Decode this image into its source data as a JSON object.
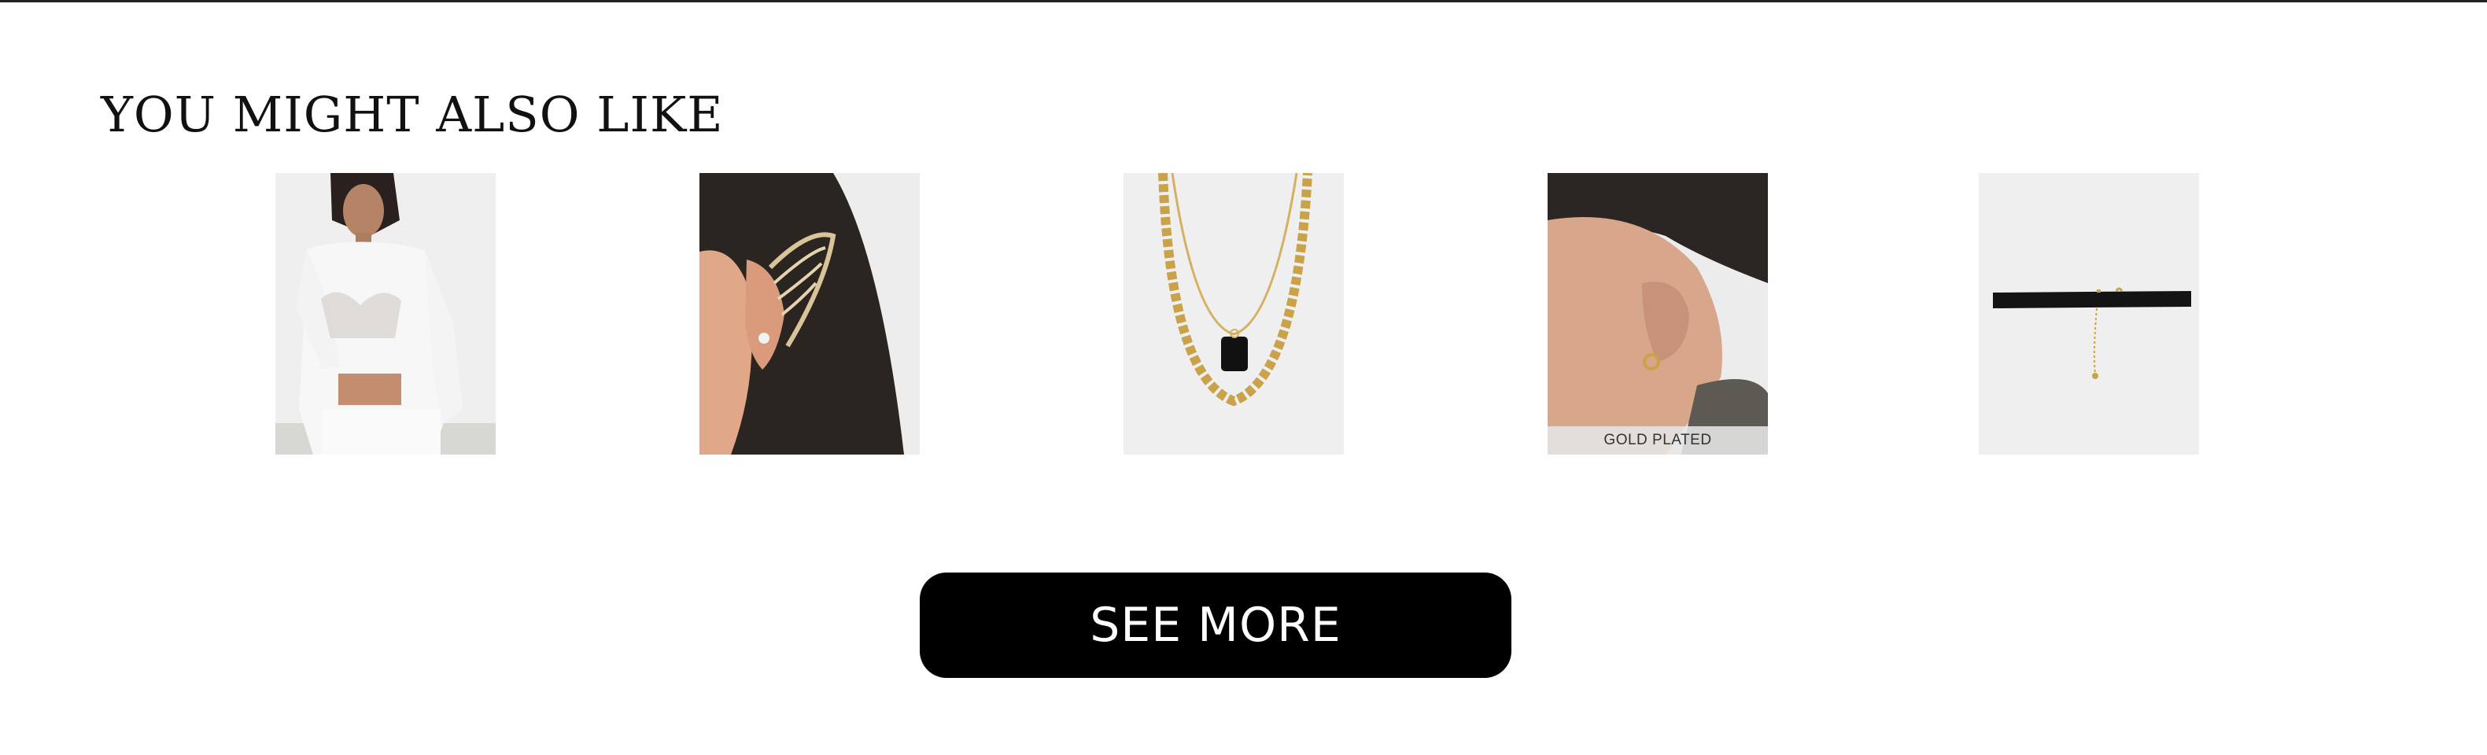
{
  "section": {
    "title": "YOU MIGHT ALSO LIKE"
  },
  "products": [
    {
      "icon": "model-mesh-top-image"
    },
    {
      "icon": "ear-cuff-image"
    },
    {
      "icon": "layered-necklace-image"
    },
    {
      "icon": "huggie-earring-image",
      "badge": "GOLD PLATED"
    },
    {
      "icon": "choker-image"
    }
  ],
  "actions": {
    "see_more_label": "SEE MORE"
  },
  "colors": {
    "button_bg": "#000000",
    "button_text": "#ffffff",
    "tile_bg": "#eeeeee"
  }
}
